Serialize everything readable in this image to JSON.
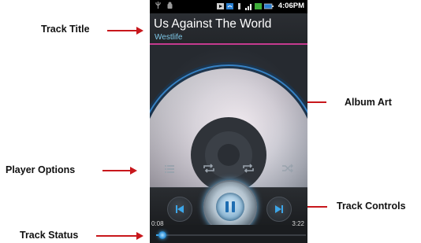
{
  "annotations": {
    "track_title": "Track Title",
    "album_art": "Album Art",
    "player_options": "Player Options",
    "track_controls": "Track Controls",
    "track_status": "Track Status"
  },
  "status_bar": {
    "time": "4:06PM"
  },
  "now_playing": {
    "title": "Us Against The World",
    "artist": "Westlife"
  },
  "player_options": {
    "icons": [
      "playlist-icon",
      "repeat-icon",
      "repeat-alt-icon",
      "shuffle-icon"
    ]
  },
  "controls": {
    "icons": [
      "previous-icon",
      "pause-icon",
      "next-icon"
    ]
  },
  "progress": {
    "elapsed": "0:08",
    "total": "3:22",
    "fraction": 0.04
  },
  "colors": {
    "accent_blue": "#3da6e8",
    "title_divider": "#c53a8f",
    "artist_text": "#7ec8e8",
    "annotation_arrow": "#c8171c"
  }
}
